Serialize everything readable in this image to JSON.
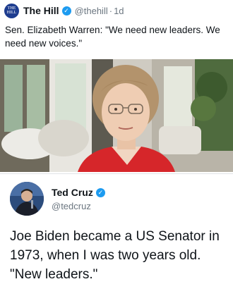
{
  "tweet1": {
    "avatar_text": "THE HILL",
    "name": "The Hill",
    "handle": "@thehill",
    "separator": "·",
    "time": "1d",
    "text": "Sen. Elizabeth Warren: \"We need new leaders. We need new voices.\""
  },
  "tweet2": {
    "name": "Ted Cruz",
    "handle": "@tedcruz",
    "text": "Joe Biden became a US Senator in 1973, when I was two years old. \"New leaders.\""
  },
  "colors": {
    "verified": "#1d9bf0",
    "hill_brand": "#1d3c8f",
    "secondary_text": "#6b7680",
    "jacket": "#d6262a"
  },
  "icons": {
    "verified": "verified-badge-icon"
  }
}
